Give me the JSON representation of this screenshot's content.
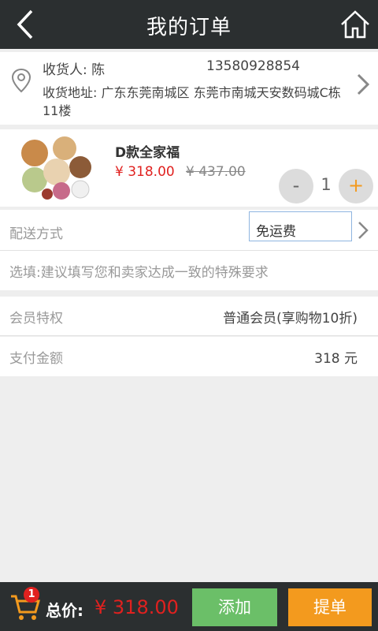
{
  "header": {
    "title": "我的订单",
    "back_icon": "chevron-left-icon",
    "home_icon": "home-icon"
  },
  "address": {
    "name": "收货人: 陈",
    "phone": "13580928854",
    "full": "收货地址: 广东东莞南城区 东莞市南城天安数码城C栋11楼"
  },
  "product": {
    "name": "D款全家福",
    "price": "¥ 318.00",
    "original_price": "¥ 437.00",
    "quantity": "1",
    "minus": "-",
    "plus": "+"
  },
  "shipping": {
    "label": "配送方式",
    "value": "免运费"
  },
  "note": {
    "placeholder": "选填:建议填写您和卖家达成一致的特殊要求"
  },
  "member": {
    "label": "会员特权",
    "value": "普通会员(享购物10折)"
  },
  "payment": {
    "label": "支付金额",
    "value": "318 元"
  },
  "footer": {
    "badge": "1",
    "total_label": "总价:",
    "total": "¥ 318.00",
    "add_button": "添加",
    "order_button": "提单"
  },
  "colors": {
    "bar": "#2b2f30",
    "price": "#e0211f",
    "add": "#6bbf68",
    "order": "#f39a1e"
  }
}
